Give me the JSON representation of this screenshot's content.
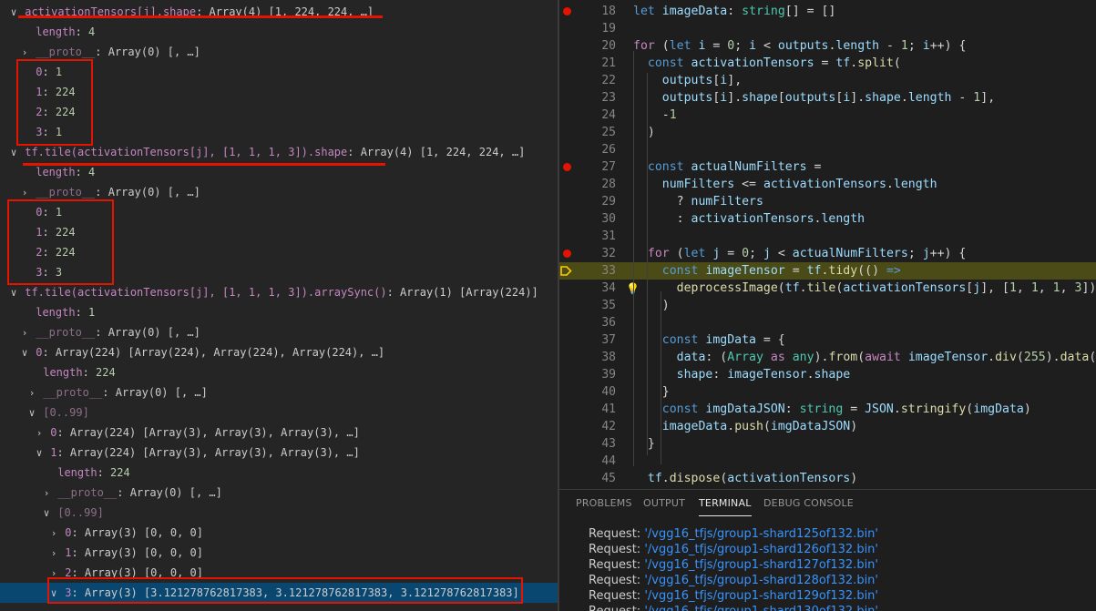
{
  "variables": {
    "rows": [
      {
        "indent": 0,
        "twisty": "down",
        "key": "activationTensors[j].shape",
        "val": "Array(4) [1, 224, 224, …]"
      },
      {
        "indent": 1,
        "twisty": "",
        "key": "length",
        "val": "4",
        "num": true
      },
      {
        "indent": 1,
        "twisty": "right",
        "key": "__proto__",
        "val": "Array(0) [, …]",
        "dim": true
      },
      {
        "indent": 1,
        "twisty": "",
        "key": "0",
        "val": "1",
        "num": true
      },
      {
        "indent": 1,
        "twisty": "",
        "key": "1",
        "val": "224",
        "num": true
      },
      {
        "indent": 1,
        "twisty": "",
        "key": "2",
        "val": "224",
        "num": true
      },
      {
        "indent": 1,
        "twisty": "",
        "key": "3",
        "val": "1",
        "num": true
      },
      {
        "indent": 0,
        "twisty": "down",
        "key": "tf.tile(activationTensors[j], [1, 1, 1, 3]).shape",
        "val": "Array(4) [1, 224, 224, …]"
      },
      {
        "indent": 1,
        "twisty": "",
        "key": "length",
        "val": "4",
        "num": true
      },
      {
        "indent": 1,
        "twisty": "right",
        "key": "__proto__",
        "val": "Array(0) [, …]",
        "dim": true
      },
      {
        "indent": 1,
        "twisty": "",
        "key": "0",
        "val": "1",
        "num": true
      },
      {
        "indent": 1,
        "twisty": "",
        "key": "1",
        "val": "224",
        "num": true
      },
      {
        "indent": 1,
        "twisty": "",
        "key": "2",
        "val": "224",
        "num": true
      },
      {
        "indent": 1,
        "twisty": "",
        "key": "3",
        "val": "3",
        "num": true
      },
      {
        "indent": 0,
        "twisty": "down",
        "key": "tf.tile(activationTensors[j], [1, 1, 1, 3]).arraySync()",
        "val": "Array(1) [Array(224)]"
      },
      {
        "indent": 1,
        "twisty": "",
        "key": "length",
        "val": "1",
        "num": true
      },
      {
        "indent": 1,
        "twisty": "right",
        "key": "__proto__",
        "val": "Array(0) [, …]",
        "dim": true
      },
      {
        "indent": 1,
        "twisty": "down",
        "key": "0",
        "val": "Array(224) [Array(224), Array(224), Array(224), …]"
      },
      {
        "indent": 2,
        "twisty": "",
        "key": "length",
        "val": "224",
        "num": true
      },
      {
        "indent": 2,
        "twisty": "right",
        "key": "__proto__",
        "val": "Array(0) [, …]",
        "dim": true
      },
      {
        "indent": 2,
        "twisty": "down",
        "key": "[0..99]",
        "val": "",
        "dim": true,
        "group": true
      },
      {
        "indent": 3,
        "twisty": "right",
        "key": "0",
        "val": "Array(224) [Array(3), Array(3), Array(3), …]"
      },
      {
        "indent": 3,
        "twisty": "down",
        "key": "1",
        "val": "Array(224) [Array(3), Array(3), Array(3), …]"
      },
      {
        "indent": 4,
        "twisty": "",
        "key": "length",
        "val": "224",
        "num": true
      },
      {
        "indent": 4,
        "twisty": "right",
        "key": "__proto__",
        "val": "Array(0) [, …]",
        "dim": true
      },
      {
        "indent": 4,
        "twisty": "down",
        "key": "[0..99]",
        "val": "",
        "dim": true,
        "group": true
      },
      {
        "indent": 5,
        "twisty": "right",
        "key": "0",
        "val": "Array(3) [0, 0, 0]"
      },
      {
        "indent": 5,
        "twisty": "right",
        "key": "1",
        "val": "Array(3) [0, 0, 0]"
      },
      {
        "indent": 5,
        "twisty": "right",
        "key": "2",
        "val": "Array(3) [0, 0, 0]"
      },
      {
        "indent": 5,
        "twisty": "down",
        "key": "3",
        "val": "Array(3) [3.121278762817383, 3.121278762817383, 3.121278762817383]",
        "selected": true
      }
    ]
  },
  "editor": {
    "lines": [
      {
        "n": "18",
        "bp": true,
        "t": [
          [
            "kw",
            "let "
          ],
          [
            "var",
            "imageData"
          ],
          [
            "p",
            ": "
          ],
          [
            "type",
            "string"
          ],
          [
            "p",
            "[] = []"
          ]
        ]
      },
      {
        "n": "19",
        "t": []
      },
      {
        "n": "20",
        "t": [
          [
            "ctl",
            "for"
          ],
          [
            "p",
            " ("
          ],
          [
            "kw",
            "let "
          ],
          [
            "var",
            "i"
          ],
          [
            "p",
            " = "
          ],
          [
            "num",
            "0"
          ],
          [
            "p",
            "; "
          ],
          [
            "var",
            "i"
          ],
          [
            "p",
            " < "
          ],
          [
            "var",
            "outputs"
          ],
          [
            "p",
            "."
          ],
          [
            "var",
            "length"
          ],
          [
            "p",
            " - "
          ],
          [
            "num",
            "1"
          ],
          [
            "p",
            "; "
          ],
          [
            "var",
            "i"
          ],
          [
            "p",
            "++) {"
          ]
        ]
      },
      {
        "n": "21",
        "t": [
          [
            "p",
            "  "
          ],
          [
            "kw",
            "const "
          ],
          [
            "var",
            "activationTensors"
          ],
          [
            "p",
            " = "
          ],
          [
            "var",
            "tf"
          ],
          [
            "p",
            "."
          ],
          [
            "fn",
            "split"
          ],
          [
            "p",
            "("
          ]
        ]
      },
      {
        "n": "22",
        "t": [
          [
            "p",
            "    "
          ],
          [
            "var",
            "outputs"
          ],
          [
            "p",
            "["
          ],
          [
            "var",
            "i"
          ],
          [
            "p",
            "],"
          ]
        ]
      },
      {
        "n": "23",
        "t": [
          [
            "p",
            "    "
          ],
          [
            "var",
            "outputs"
          ],
          [
            "p",
            "["
          ],
          [
            "var",
            "i"
          ],
          [
            "p",
            "]."
          ],
          [
            "var",
            "shape"
          ],
          [
            "p",
            "["
          ],
          [
            "var",
            "outputs"
          ],
          [
            "p",
            "["
          ],
          [
            "var",
            "i"
          ],
          [
            "p",
            "]."
          ],
          [
            "var",
            "shape"
          ],
          [
            "p",
            "."
          ],
          [
            "var",
            "length"
          ],
          [
            "p",
            " - "
          ],
          [
            "num",
            "1"
          ],
          [
            "p",
            "],"
          ]
        ]
      },
      {
        "n": "24",
        "t": [
          [
            "p",
            "    -"
          ],
          [
            "num",
            "1"
          ]
        ]
      },
      {
        "n": "25",
        "t": [
          [
            "p",
            "  )"
          ]
        ]
      },
      {
        "n": "26",
        "t": []
      },
      {
        "n": "27",
        "bp": true,
        "t": [
          [
            "p",
            "  "
          ],
          [
            "kw",
            "const "
          ],
          [
            "var",
            "actualNumFilters"
          ],
          [
            "p",
            " ="
          ]
        ]
      },
      {
        "n": "28",
        "t": [
          [
            "p",
            "    "
          ],
          [
            "var",
            "numFilters"
          ],
          [
            "p",
            " <= "
          ],
          [
            "var",
            "activationTensors"
          ],
          [
            "p",
            "."
          ],
          [
            "var",
            "length"
          ]
        ]
      },
      {
        "n": "29",
        "t": [
          [
            "p",
            "      ? "
          ],
          [
            "var",
            "numFilters"
          ]
        ]
      },
      {
        "n": "30",
        "t": [
          [
            "p",
            "      : "
          ],
          [
            "var",
            "activationTensors"
          ],
          [
            "p",
            "."
          ],
          [
            "var",
            "length"
          ]
        ]
      },
      {
        "n": "31",
        "t": []
      },
      {
        "n": "32",
        "bp": true,
        "t": [
          [
            "p",
            "  "
          ],
          [
            "ctl",
            "for"
          ],
          [
            "p",
            " ("
          ],
          [
            "kw",
            "let "
          ],
          [
            "var",
            "j"
          ],
          [
            "p",
            " = "
          ],
          [
            "num",
            "0"
          ],
          [
            "p",
            "; "
          ],
          [
            "var",
            "j"
          ],
          [
            "p",
            " < "
          ],
          [
            "var",
            "actualNumFilters"
          ],
          [
            "p",
            "; "
          ],
          [
            "var",
            "j"
          ],
          [
            "p",
            "++) {"
          ]
        ]
      },
      {
        "n": "33",
        "current": true,
        "t": [
          [
            "p",
            "    "
          ],
          [
            "kw",
            "const "
          ],
          [
            "var",
            "imageTensor"
          ],
          [
            "p",
            " = "
          ],
          [
            "var",
            "tf"
          ],
          [
            "p",
            "."
          ],
          [
            "fn",
            "tidy"
          ],
          [
            "p",
            "(() "
          ],
          [
            "kw",
            "=>"
          ]
        ]
      },
      {
        "n": "34",
        "bulb": true,
        "t": [
          [
            "p",
            "      "
          ],
          [
            "fn",
            "deprocessImage"
          ],
          [
            "p",
            "("
          ],
          [
            "var",
            "tf"
          ],
          [
            "p",
            "."
          ],
          [
            "fn",
            "tile"
          ],
          [
            "p",
            "("
          ],
          [
            "var",
            "activationTensors"
          ],
          [
            "p",
            "["
          ],
          [
            "var",
            "j"
          ],
          [
            "p",
            "], ["
          ],
          [
            "num",
            "1"
          ],
          [
            "p",
            ", "
          ],
          [
            "num",
            "1"
          ],
          [
            "p",
            ", "
          ],
          [
            "num",
            "1"
          ],
          [
            "p",
            ", "
          ],
          [
            "num",
            "3"
          ],
          [
            "p",
            "]))"
          ]
        ]
      },
      {
        "n": "35",
        "t": [
          [
            "p",
            "    )"
          ]
        ]
      },
      {
        "n": "36",
        "t": []
      },
      {
        "n": "37",
        "t": [
          [
            "p",
            "    "
          ],
          [
            "kw",
            "const "
          ],
          [
            "var",
            "imgData"
          ],
          [
            "p",
            " = {"
          ]
        ]
      },
      {
        "n": "38",
        "t": [
          [
            "p",
            "      "
          ],
          [
            "var",
            "data"
          ],
          [
            "p",
            ": ("
          ],
          [
            "type",
            "Array"
          ],
          [
            "p",
            " "
          ],
          [
            "ctl",
            "as"
          ],
          [
            "p",
            " "
          ],
          [
            "type",
            "any"
          ],
          [
            "p",
            ")."
          ],
          [
            "fn",
            "from"
          ],
          [
            "p",
            "("
          ],
          [
            "ctl",
            "await "
          ],
          [
            "var",
            "imageTensor"
          ],
          [
            "p",
            "."
          ],
          [
            "fn",
            "div"
          ],
          [
            "p",
            "("
          ],
          [
            "num",
            "255"
          ],
          [
            "p",
            ")."
          ],
          [
            "fn",
            "data"
          ],
          [
            "p",
            "())"
          ]
        ]
      },
      {
        "n": "39",
        "t": [
          [
            "p",
            "      "
          ],
          [
            "var",
            "shape"
          ],
          [
            "p",
            ": "
          ],
          [
            "var",
            "imageTensor"
          ],
          [
            "p",
            "."
          ],
          [
            "var",
            "shape"
          ]
        ]
      },
      {
        "n": "40",
        "t": [
          [
            "p",
            "    }"
          ]
        ]
      },
      {
        "n": "41",
        "t": [
          [
            "p",
            "    "
          ],
          [
            "kw",
            "const "
          ],
          [
            "var",
            "imgDataJSON"
          ],
          [
            "p",
            ": "
          ],
          [
            "type",
            "string"
          ],
          [
            "p",
            " = "
          ],
          [
            "var",
            "JSON"
          ],
          [
            "p",
            "."
          ],
          [
            "fn",
            "stringify"
          ],
          [
            "p",
            "("
          ],
          [
            "var",
            "imgData"
          ],
          [
            "p",
            ")"
          ]
        ]
      },
      {
        "n": "42",
        "t": [
          [
            "p",
            "    "
          ],
          [
            "var",
            "imageData"
          ],
          [
            "p",
            "."
          ],
          [
            "fn",
            "push"
          ],
          [
            "p",
            "("
          ],
          [
            "var",
            "imgDataJSON"
          ],
          [
            "p",
            ")"
          ]
        ]
      },
      {
        "n": "43",
        "t": [
          [
            "p",
            "  }"
          ]
        ]
      },
      {
        "n": "44",
        "t": []
      },
      {
        "n": "45",
        "t": [
          [
            "p",
            "  "
          ],
          [
            "var",
            "tf"
          ],
          [
            "p",
            "."
          ],
          [
            "fn",
            "dispose"
          ],
          [
            "p",
            "("
          ],
          [
            "var",
            "activationTensors"
          ],
          [
            "p",
            ")"
          ]
        ]
      }
    ]
  },
  "panel": {
    "tabs": [
      "PROBLEMS",
      "OUTPUT",
      "TERMINAL",
      "DEBUG CONSOLE"
    ],
    "active_tab": "TERMINAL",
    "terminal_lines": [
      {
        "prefix": "Request: ",
        "quote": "'",
        "path": "/vgg16_tfjs/group1-shard125of132.bin"
      },
      {
        "prefix": "Request: ",
        "quote": "'",
        "path": "/vgg16_tfjs/group1-shard126of132.bin"
      },
      {
        "prefix": "Request: ",
        "quote": "'",
        "path": "/vgg16_tfjs/group1-shard127of132.bin"
      },
      {
        "prefix": "Request: ",
        "quote": "'",
        "path": "/vgg16_tfjs/group1-shard128of132.bin"
      },
      {
        "prefix": "Request: ",
        "quote": "'",
        "path": "/vgg16_tfjs/group1-shard129of132.bin"
      },
      {
        "prefix": "Request: ",
        "quote": "'",
        "path": "/vgg16_tfjs/group1-shard130of132.bin"
      }
    ]
  },
  "colors": {
    "accent_red": "#e51400",
    "selection": "#094771",
    "current_line": "#4b4b18",
    "link": "#3794ff"
  }
}
